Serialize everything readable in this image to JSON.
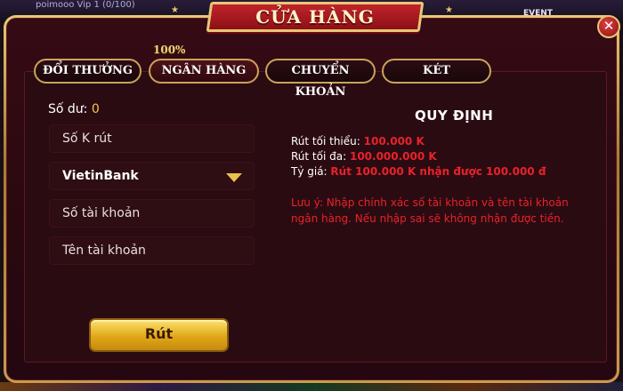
{
  "background": {
    "user": "poimooo\nVip 1 (0/100)",
    "event_label": "EVENT"
  },
  "header": {
    "title": "CỬA HÀNG"
  },
  "close_symbol": "✕",
  "tabs": [
    {
      "label": "ĐỔI THƯỞNG",
      "active": false
    },
    {
      "label": "NGÂN HÀNG",
      "active": true,
      "badge": "100%"
    },
    {
      "label": "CHUYỂN KHOẢN",
      "active": false
    },
    {
      "label": "KÉT",
      "active": false
    }
  ],
  "form": {
    "balance_label": "Số dư:",
    "balance_value": "0",
    "amount_placeholder": "Số K rút",
    "bank_selected": "VietinBank",
    "account_number_placeholder": "Số tài khoản",
    "account_name_placeholder": "Tên tài khoản",
    "submit_label": "Rút"
  },
  "rules": {
    "title": "QUY ĐỊNH",
    "min_label": "Rút tối thiểu:",
    "min_value": "100.000 K",
    "max_label": "Rút tối đa:",
    "max_value": "100.000.000 K",
    "rate_label": "Tỷ giá:",
    "rate_value": "Rút 100.000 K nhận được 100.000 đ",
    "note": "Lưu ý: Nhập chính xác số tài khoản và tên tài khoản ngân hàng. Nếu nhập sai sẽ không nhận được tiền."
  },
  "colors": {
    "accent_gold": "#e8c776",
    "alert_red": "#e8222a",
    "button_gold": "#e0a818"
  }
}
